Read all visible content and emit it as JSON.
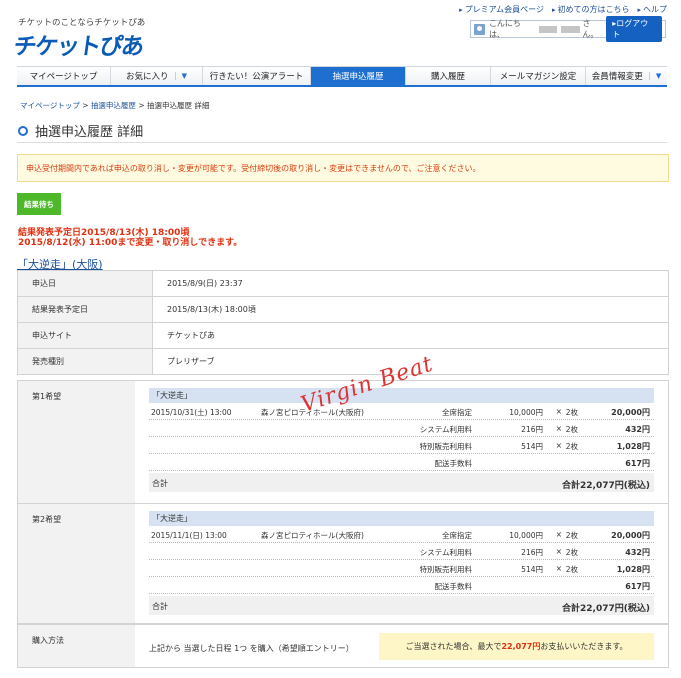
{
  "header": {
    "tagline": "チケットのことならチケットぴあ",
    "logo_text": "チケットぴあ",
    "links": [
      "プレミアム会員ページ",
      "初めての方はこちら",
      "ヘルプ"
    ],
    "greeting_prefix": "こんにちは、",
    "greeting_suffix": "さん。",
    "logout_label": "ログアウト"
  },
  "nav": {
    "items": [
      "マイページトップ",
      "お気に入り",
      "行きたい！公演アラート",
      "抽選申込履歴",
      "購入履歴",
      "メールマガジン設定",
      "会員情報変更"
    ],
    "active_index": 3
  },
  "breadcrumb": [
    "マイページトップ",
    "抽選申込履歴",
    "抽選申込履歴 詳細"
  ],
  "breadcrumb_sep": ">",
  "page_title": "抽選申込履歴 詳細",
  "notice": "申込受付期間内であれば申込の取り消し・変更が可能です。受付締切後の取り消し・変更はできませんので、ご注意ください。",
  "status_badge": "結果待ち",
  "result_message": {
    "line1": "結果発表予定日2015/8/13(木) 18:00頃",
    "line2": "2015/8/12(水) 11:00まで変更・取り消しできます。"
  },
  "event_link": "「大逆走」(大阪)",
  "info_rows": [
    {
      "label": "申込日",
      "value": "2015/8/9(日) 23:37"
    },
    {
      "label": "結果発表予定日",
      "value": "2015/8/13(木) 18:00頃"
    },
    {
      "label": "申込サイト",
      "value": "チケットぴあ"
    },
    {
      "label": "発売種別",
      "value": "プレリザーブ"
    }
  ],
  "choices": [
    {
      "label": "第1希望",
      "title": "「大逆走」",
      "date": "2015/10/31(土) 13:00",
      "venue": "森ノ宮ピロティホール(大阪府)",
      "lines": [
        {
          "name": "全席指定",
          "unit": "10,000円",
          "x": "×",
          "qty": "2枚",
          "total": "20,000円"
        },
        {
          "name": "システム利用料",
          "unit": "216円",
          "x": "×",
          "qty": "2枚",
          "total": "432円"
        },
        {
          "name": "特別販売利用料",
          "unit": "514円",
          "x": "×",
          "qty": "2枚",
          "total": "1,028円"
        },
        {
          "name": "配送手数料",
          "unit": "",
          "x": "",
          "qty": "",
          "total": "617円"
        }
      ],
      "total_label": "合計",
      "total_value": "合計22,077円(税込)"
    },
    {
      "label": "第2希望",
      "title": "「大逆走」",
      "date": "2015/11/1(日) 13:00",
      "venue": "森ノ宮ピロティホール(大阪府)",
      "lines": [
        {
          "name": "全席指定",
          "unit": "10,000円",
          "x": "×",
          "qty": "2枚",
          "total": "20,000円"
        },
        {
          "name": "システム利用料",
          "unit": "216円",
          "x": "×",
          "qty": "2枚",
          "total": "432円"
        },
        {
          "name": "特別販売利用料",
          "unit": "514円",
          "x": "×",
          "qty": "2枚",
          "total": "1,028円"
        },
        {
          "name": "配送手数料",
          "unit": "",
          "x": "",
          "qty": "",
          "total": "617円"
        }
      ],
      "total_label": "合計",
      "total_value": "合計22,077円(税込)"
    }
  ],
  "purchase": {
    "label": "購入方法",
    "method": "上記から 当選した日程 1つ を購入（希望順エントリー）",
    "pay_prefix": "ご当選された場合、最大で",
    "pay_amount": "22,077円",
    "pay_suffix": "お支払いいただきます。"
  },
  "watermark": "Virgin Beat",
  "colors": {
    "accent": "#1e6fd0",
    "alert": "#e03010",
    "status": "#4eb82b"
  }
}
